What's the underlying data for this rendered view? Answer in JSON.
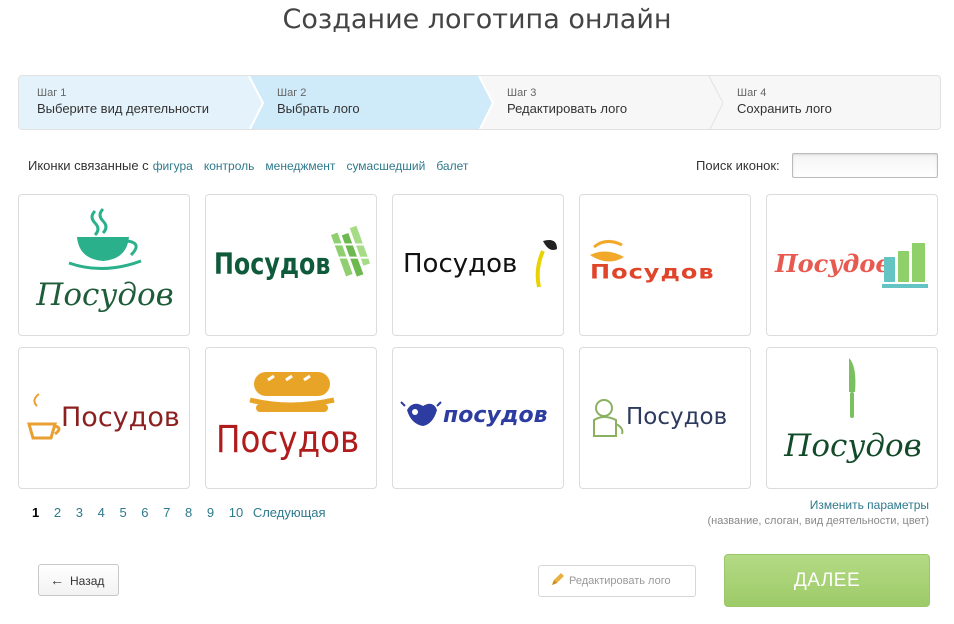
{
  "page": {
    "title": "Создание логотипа онлайн"
  },
  "steps": [
    {
      "number": "Шаг 1",
      "label": "Выберите вид деятельности"
    },
    {
      "number": "Шаг 2",
      "label": "Выбрать лого"
    },
    {
      "number": "Шаг 3",
      "label": "Редактировать лого"
    },
    {
      "number": "Шаг 4",
      "label": "Сохранить лого"
    }
  ],
  "related": {
    "prefix": "Иконки связанные с",
    "tags": [
      "фигура",
      "контроль",
      "менеджмент",
      "сумасшедший",
      "балет"
    ]
  },
  "search": {
    "label": "Поиск иконок:",
    "value": ""
  },
  "logos": [
    {
      "text": "Посудов",
      "color": "#1e5c3a",
      "icon": "tea-cup-icon"
    },
    {
      "text": "Посудов",
      "color": "#0f5a3a",
      "icon": "pencils-icon"
    },
    {
      "text": "Посудов",
      "color": "#111111",
      "icon": "leaf-pen-icon"
    },
    {
      "text": "Посудов",
      "color": "#e0452a",
      "icon": "bowl-icon"
    },
    {
      "text": "Посудов",
      "color": "#e85a50",
      "icon": "bar-chart-icon"
    },
    {
      "text": "Посудов",
      "color": "#8c2020",
      "icon": "coffee-cup-icon"
    },
    {
      "text": "Посудов",
      "color": "#b01c1c",
      "icon": "sandwich-icon"
    },
    {
      "text": "посудов",
      "color": "#2c3ca0",
      "icon": "frog-splash-icon"
    },
    {
      "text": "Посудов",
      "color": "#2d3a5e",
      "icon": "chef-icon"
    },
    {
      "text": "Посудов",
      "color": "#124a2a",
      "icon": "knife-icon"
    }
  ],
  "pagination": {
    "pages": [
      "1",
      "2",
      "3",
      "4",
      "5",
      "6",
      "7",
      "8",
      "9",
      "10"
    ],
    "current": "1",
    "next_label": "Следующая"
  },
  "params": {
    "link": "Изменить параметры",
    "hint": "(название, слоган, вид деятельности, цвет)"
  },
  "buttons": {
    "back": "Назад",
    "edit": "Редактировать лого",
    "next": "ДАЛЕЕ"
  },
  "colors": {
    "link": "#2e7a8c",
    "active_step": "#cfeaf9",
    "done_step": "#e4f3fb",
    "next_button": "#a4cf72"
  }
}
